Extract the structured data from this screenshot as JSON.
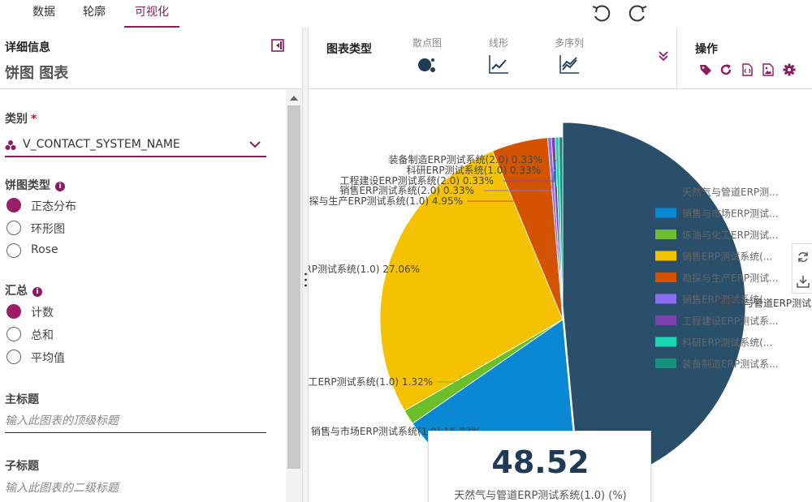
{
  "tabs": [
    "数据",
    "轮廓",
    "可视化"
  ],
  "left_panel": {
    "title": "详细信息",
    "subtitle": "饼图 图表",
    "category_label": "类别",
    "required_mark": "*",
    "category_value": "V_CONTACT_SYSTEM_NAME",
    "pie_type_label": "饼图类型",
    "pie_types": [
      "正态分布",
      "环形图",
      "Rose"
    ],
    "pie_type_selected": 0,
    "summary_label": "汇总",
    "summary_types": [
      "计数",
      "总和",
      "平均值"
    ],
    "summary_selected": 0,
    "main_title_label": "主标题",
    "main_title_placeholder": "输入此图表的顶级标题",
    "sub_title_label": "子标题",
    "sub_title_placeholder": "输入此图表的二级标题"
  },
  "chart_types": {
    "label": "图表类型",
    "items": [
      "散点图",
      "线形",
      "多序列"
    ]
  },
  "operations": {
    "label": "操作",
    "icons": [
      "tag-icon",
      "refresh-icon",
      "code-icon",
      "image-icon",
      "gear-icon"
    ]
  },
  "colors": {
    "accent": "#8b1c5e"
  },
  "chart_data": {
    "type": "pie",
    "slices": [
      {
        "name": "天然气与管道ERP测试系统(1.0)",
        "value": 48.52,
        "color": "#2a4f6b"
      },
      {
        "name": "销售与市场ERP测试系统(1.0)",
        "value": 16.83,
        "color": "#0a88d4"
      },
      {
        "name": "炼油与化工ERP测试系统(1.0)",
        "value": 1.32,
        "color": "#6cbf2a"
      },
      {
        "name": "销售ERP测试系统(1.0)",
        "value": 27.06,
        "color": "#f5c200"
      },
      {
        "name": "勘探与生产ERP测试系统(1.0)",
        "value": 4.95,
        "color": "#d35400"
      },
      {
        "name": "销售ERP测试系统(2.0)",
        "value": 0.33,
        "color": "#8c6cf0"
      },
      {
        "name": "工程建设ERP测试系统(2.0)",
        "value": 0.33,
        "color": "#7d3fb0"
      },
      {
        "name": "科研ERP测试系统(1.0)",
        "value": 0.33,
        "color": "#17d6b0"
      },
      {
        "name": "装备制造ERP测试系统(2.0)",
        "value": 0.33,
        "color": "#138f7a"
      }
    ],
    "data_labels": [
      "装备制造ERP测试系统(2.0) 0.33%",
      "科研ERP测试系统(1.0) 0.33%",
      "工程建设ERP测试系统(2.0) 0.33%",
      "销售ERP测试系统(2.0) 0.33%",
      "探与生产ERP测试系统(1.0) 4.95%",
      "ERP测试系统(1.0) 27.06%",
      "工ERP测试系统(1.0) 1.32%",
      "销售与市场ERP测试系统(1.0) 16.83%"
    ],
    "legend": [
      "天然气与管道ERP测...",
      "销售与市场ERP测试...",
      "炼油与化工ERP测试...",
      "销售ERP测试系统(...",
      "勘探与生产ERP测试...",
      "销售ERP测试系统(...",
      "工程建设ERP测试系...",
      "科研ERP测试系统(...",
      "装备制造ERP测试系..."
    ],
    "legend_position": "right",
    "overlay_label": "天然气与管道ERP测试"
  },
  "tooltip": {
    "value": "48.52",
    "label": "天然气与管道ERP测试系统(1.0) (%)"
  }
}
